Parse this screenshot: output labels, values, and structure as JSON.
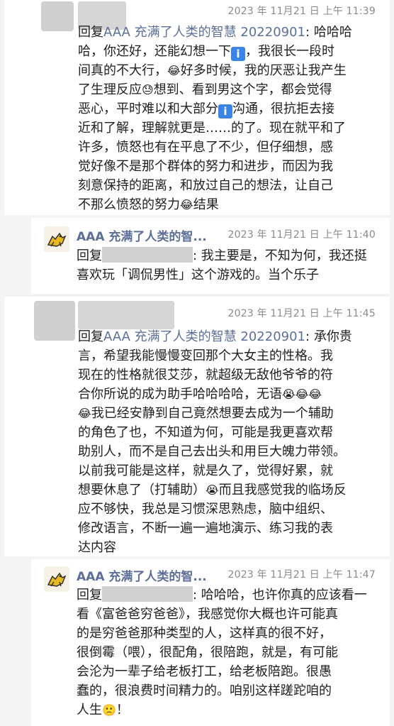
{
  "posts": [
    {
      "timestamp": "2023 年 11月21 日 上午 11:39",
      "reply_prefix": "回复",
      "mention": "AAA 充满了人类的智慧 20220901",
      "colon": ":",
      "lines": [
        "哈哈哈",
        "哈，你还好，还能幻想一下",
        "，我很长一段时",
        "间真的不大行，",
        "好多时候，我的厌恶让我产生",
        "了生理反应",
        "想到、看到男这个字，都会觉得",
        "恶心，平时难以和大部分",
        "沟通，很抗拒去接",
        "近和了解，理解就更是……的了。现在就平和了",
        "许多，愤怒也有在平息了不少，但仔细想，感",
        "觉好像不是那个群体的努力和进步，而因为我",
        "刻意保持的距离，和放过自己的想法，让自己",
        "不那么愤怒的努力",
        "结果"
      ]
    },
    {
      "author": "AAA 充满了人类的智...",
      "timestamp": "2023 年 11月21 日 上午 11:40",
      "reply_prefix": "回复",
      "lines": [
        ": 我主要是，不知为何，我还挺",
        "喜欢玩「调侃男性」这个游戏的。当个乐子"
      ]
    },
    {
      "timestamp": "2023 年 11月21 日 上午 11:45",
      "reply_prefix": "回复",
      "mention": "AAA 充满了人类的智慧 20220901",
      "colon": ":",
      "lines": [
        "承你贵",
        "言，希望我能慢慢变回那个大女主的性格。我",
        "现在的性格就很艾莎，就超级无敌他爷爷的符",
        "合你所说的成为助手哈哈哈哈，无语",
        "我已经安静到自己竟然想要去成为一个辅助",
        "的角色了也，不知道为何，可能是我更喜欢帮",
        "助别人，而不是自己去出头和用巨大魄力带领。",
        "以前我可能是这样，就是久了，觉得好累，就",
        "想要休息了（打辅助）",
        "而且我感觉我的临场反",
        "应不够快，我总是习惯深思熟虑，脑中组织、",
        "修改语言，不断一遍一遍地演示、练习我的表",
        "达内容"
      ]
    },
    {
      "author": "AAA 充满了人类的智...",
      "timestamp": "2023 年 11月21 日 上午 11:47",
      "reply_prefix": "回复",
      "lines": [
        ": 哈哈哈，也许你真的应该看一",
        "看《富爸爸穷爸爸》，我感觉你大概也许可能真",
        "的是穷爸爸那种类型的人，这样真的很不好，",
        "很倒霉（喂），很配角，很陪跑，就是，有可能",
        "会沦为一辈子给老板打工，给老板陪跑。很愚",
        "蠢的，很浪费时间精力的。咱别这样蹉跎咱的",
        "人生",
        "！"
      ]
    }
  ],
  "emojis": {
    "info": "ℹ",
    "laugh": "😂",
    "sweat": "😓",
    "cry": "😭",
    "slight": "🙁"
  }
}
